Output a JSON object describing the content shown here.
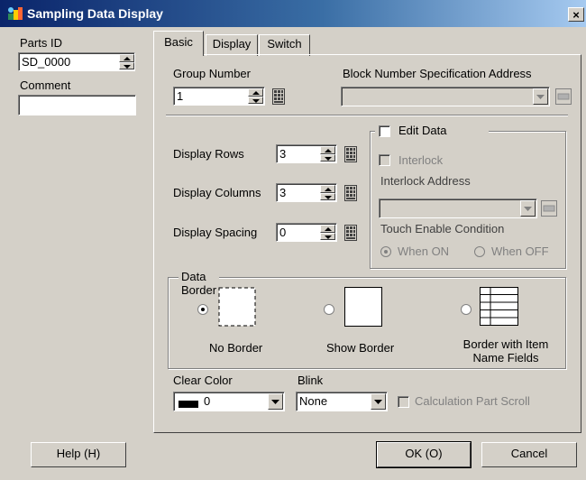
{
  "window": {
    "title": "Sampling Data Display",
    "close_label": "×"
  },
  "left_panel": {
    "parts_id_label": "Parts ID",
    "parts_id_value": "SD_0000",
    "comment_label": "Comment",
    "comment_value": ""
  },
  "tabs": [
    {
      "label": "Basic",
      "active": true
    },
    {
      "label": "Display",
      "active": false
    },
    {
      "label": "Switch",
      "active": false
    }
  ],
  "basic": {
    "group_number_label": "Group Number",
    "group_number_value": "1",
    "block_address_label": "Block Number Specification Address",
    "block_address_value": "",
    "display_rows_label": "Display Rows",
    "display_rows_value": "3",
    "display_columns_label": "Display Columns",
    "display_columns_value": "3",
    "display_spacing_label": "Display Spacing",
    "display_spacing_value": "0",
    "edit_data_label": "Edit Data",
    "interlock_label": "Interlock",
    "interlock_address_label": "Interlock Address",
    "touch_enable_label": "Touch Enable Condition",
    "when_on_label": "When ON",
    "when_off_label": "When OFF",
    "data_border_label": "Data Border",
    "border_options": [
      {
        "label": "No Border",
        "selected": true
      },
      {
        "label": "Show Border",
        "selected": false
      },
      {
        "label": "Border with Item\nName Fields",
        "selected": false
      }
    ],
    "clear_color_label": "Clear Color",
    "clear_color_value": "0",
    "clear_color_swatch": "#000000",
    "blink_label": "Blink",
    "blink_value": "None",
    "calc_scroll_label": "Calculation Part Scroll"
  },
  "buttons": {
    "help": "Help (H)",
    "ok": "OK (O)",
    "cancel": "Cancel"
  },
  "colors": {
    "title_bar_start": "#0a246a",
    "title_bar_end": "#a6caf0",
    "face": "#d4d0c8"
  }
}
